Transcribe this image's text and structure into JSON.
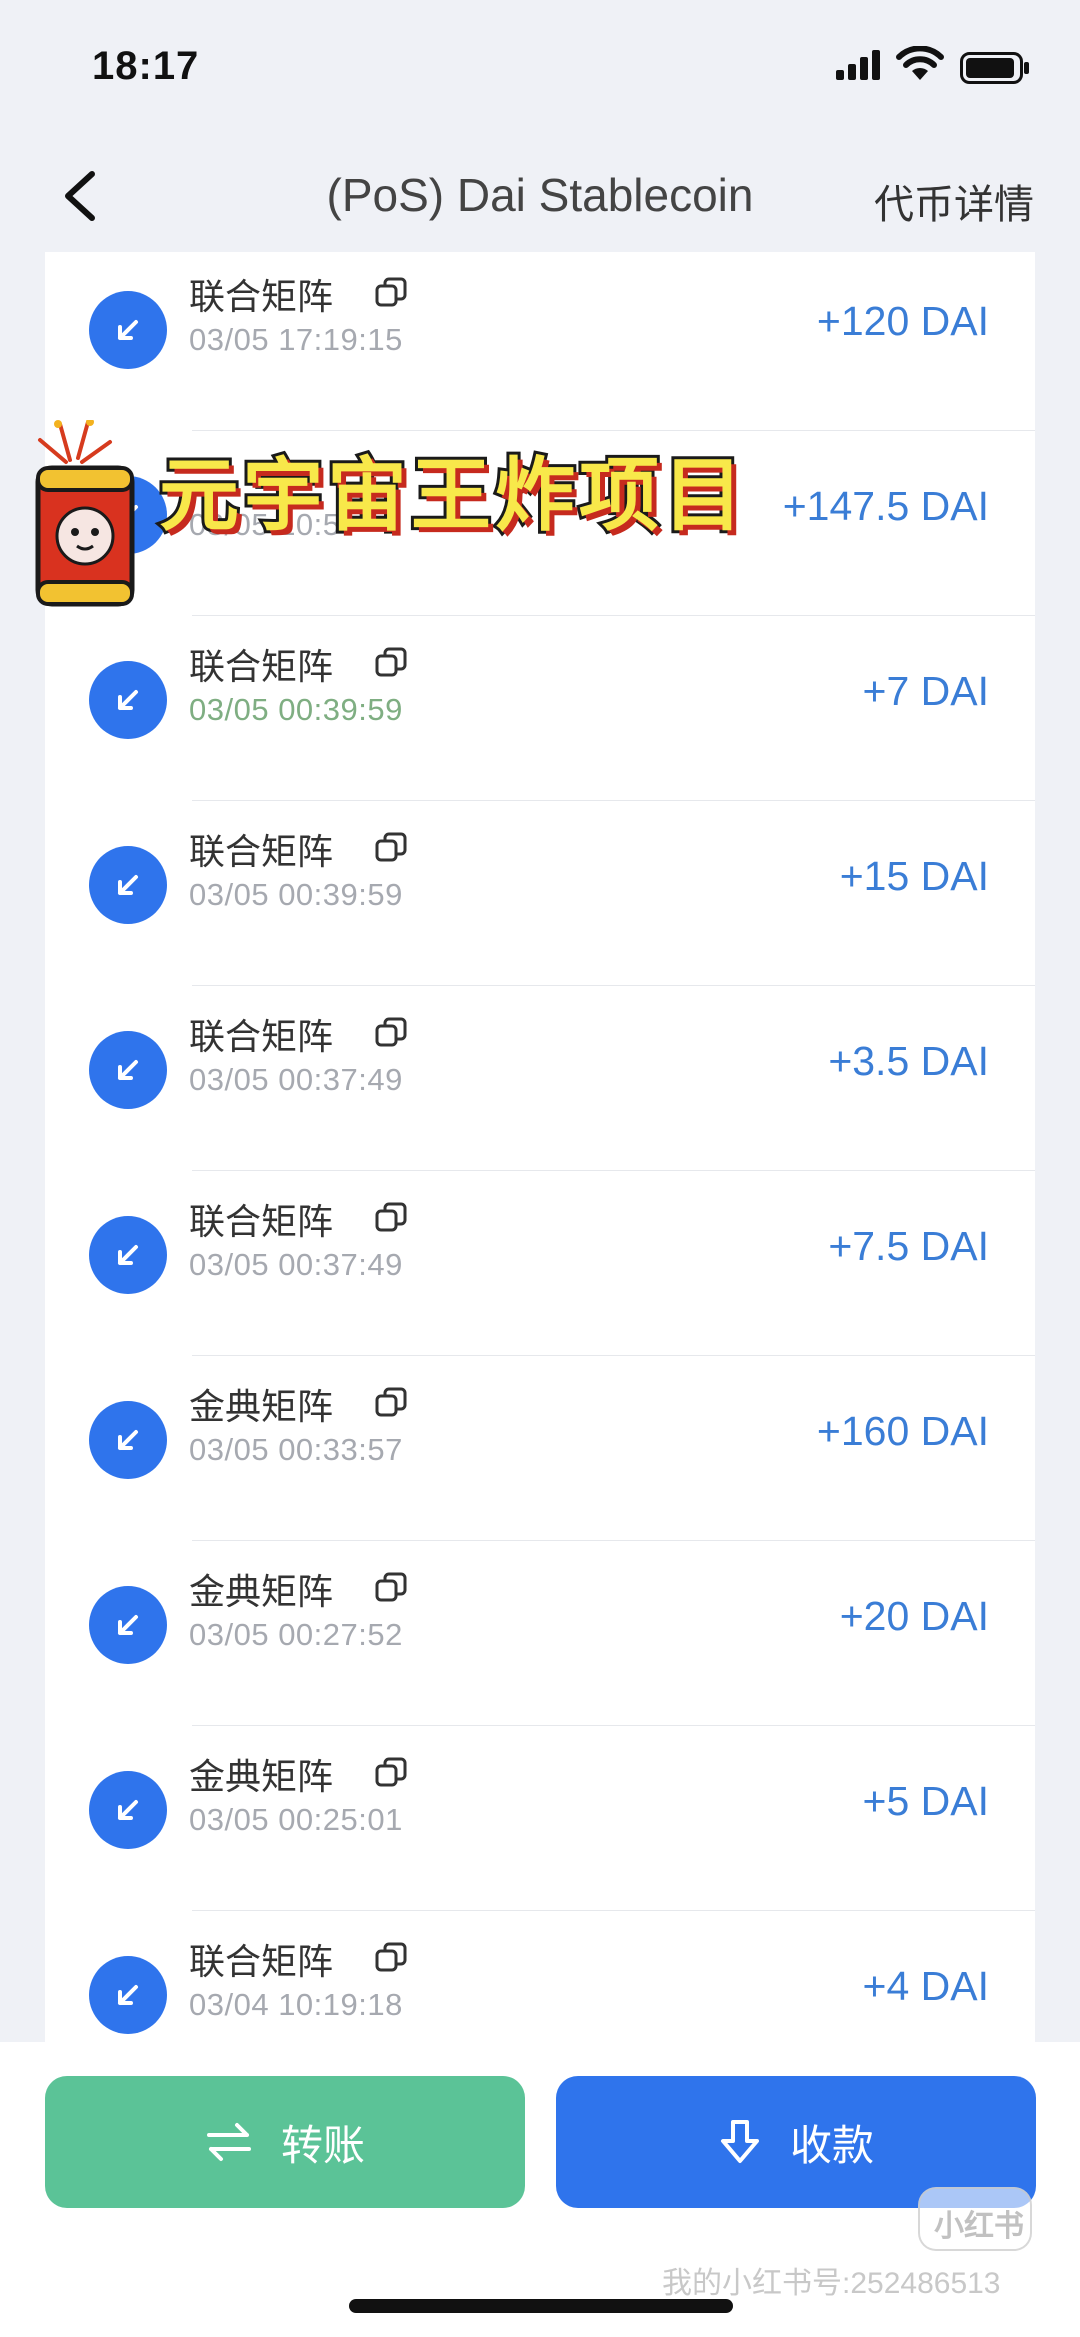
{
  "status_bar": {
    "time": "18:17"
  },
  "nav": {
    "title": "(PoS) Dai Stablecoin",
    "detail_link": "代币详情"
  },
  "transactions": [
    {
      "name": "联合矩阵",
      "time": "03/05 17:19:15",
      "amount": "+120 DAI"
    },
    {
      "name": "",
      "time": "03/05 10:5",
      "amount": "+147.5 DAI"
    },
    {
      "name": "联合矩阵",
      "time": "03/05 00:39:59",
      "amount": "+7 DAI"
    },
    {
      "name": "联合矩阵",
      "time": "03/05 00:39:59",
      "amount": "+15 DAI"
    },
    {
      "name": "联合矩阵",
      "time": "03/05 00:37:49",
      "amount": "+3.5 DAI"
    },
    {
      "name": "联合矩阵",
      "time": "03/05 00:37:49",
      "amount": "+7.5 DAI"
    },
    {
      "name": "金典矩阵",
      "time": "03/05 00:33:57",
      "amount": "+160 DAI"
    },
    {
      "name": "金典矩阵",
      "time": "03/05 00:27:52",
      "amount": "+20 DAI"
    },
    {
      "name": "金典矩阵",
      "time": "03/05 00:25:01",
      "amount": "+5 DAI"
    },
    {
      "name": "联合矩阵",
      "time": "03/04 10:19:18",
      "amount": "+4 DAI"
    }
  ],
  "overlay": {
    "banner_text": "元宇宙王炸项目"
  },
  "footer": {
    "transfer_label": "转账",
    "receive_label": "收款"
  },
  "watermark": {
    "logo_text": "小红书",
    "id_text": "我的小红书号:252486513"
  },
  "icons": {
    "back": "chevron-left-icon",
    "incoming": "arrow-down-left-icon",
    "copy": "copy-icon",
    "transfer": "swap-arrows-icon",
    "receive": "download-arrow-icon"
  },
  "colors": {
    "accent_blue": "#2f74ec",
    "amount_blue": "#3a7dd6",
    "transfer_green": "#5bc397",
    "page_bg": "#eff1f6"
  }
}
